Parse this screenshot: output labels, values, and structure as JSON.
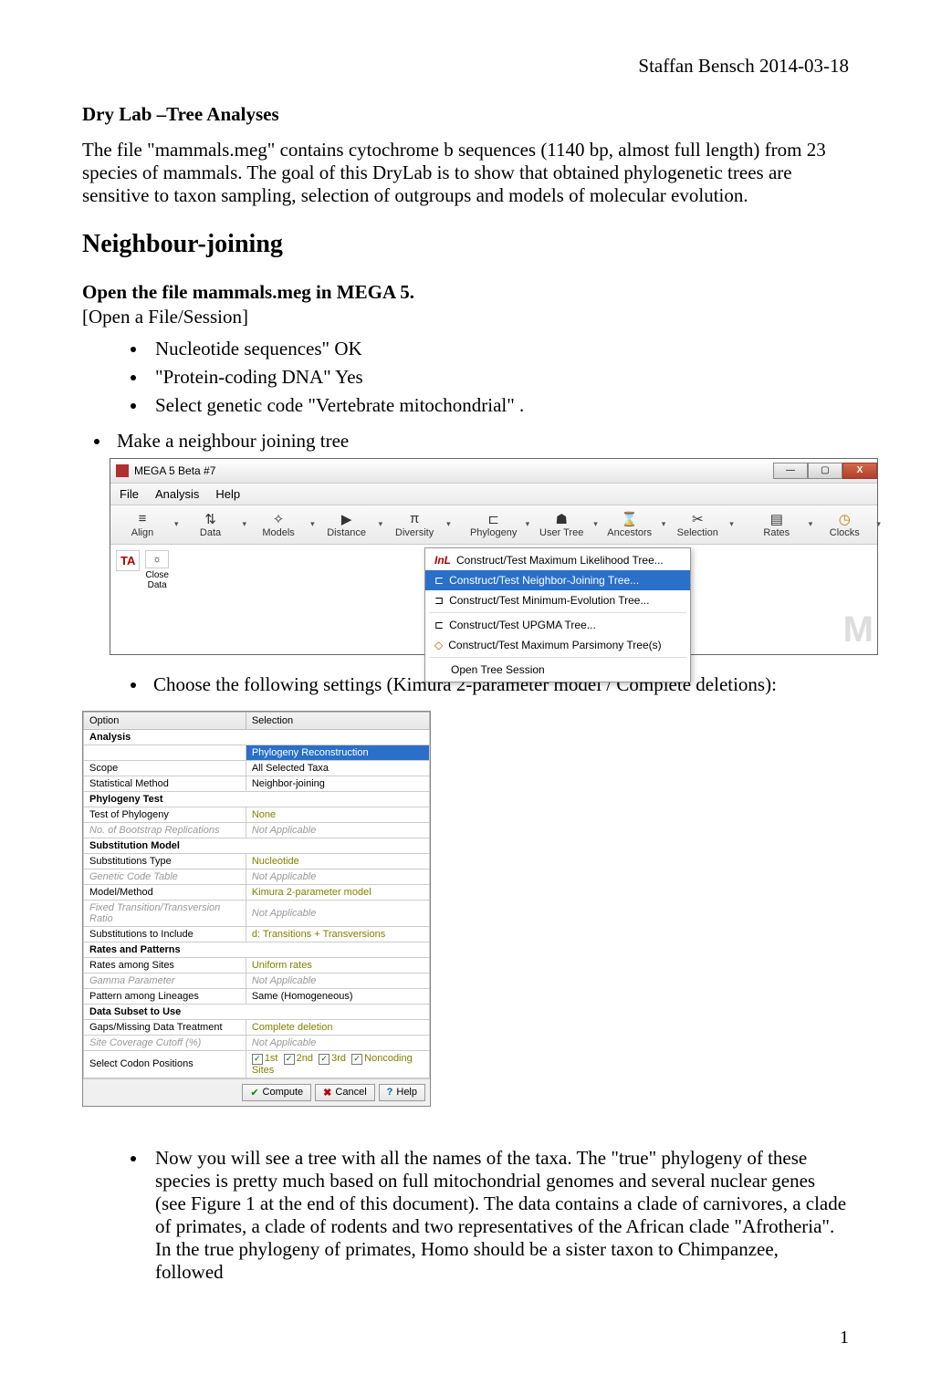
{
  "header": {
    "author_date": "Staffan Bensch 2014-03-18"
  },
  "title1": "Dry Lab –Tree Analyses",
  "intro": "The file \"mammals.meg\" contains cytochrome b sequences (1140 bp, almost full length) from 23 species of mammals. The goal of this DryLab is to show that obtained phylogenetic trees are sensitive to taxon sampling, selection of outgroups and models of molecular evolution.",
  "h1": "Neighbour-joining",
  "open_line": "Open the file mammals.meg in MEGA 5.",
  "open_sub": "[Open a File/Session]",
  "bullets_a": [
    "Nucleotide sequences\" OK",
    "\"Protein-coding DNA\" Yes",
    " Select genetic code \"Vertebrate mitochondrial\" ."
  ],
  "bullet_nj": "Make a neighbour joining tree",
  "mega": {
    "title": "MEGA 5 Beta #7",
    "menus": [
      "File",
      "Analysis",
      "Help"
    ],
    "toolbar": [
      {
        "label": "Align"
      },
      {
        "label": "Data"
      },
      {
        "label": "Models"
      },
      {
        "label": "Distance"
      },
      {
        "label": "Diversity"
      },
      {
        "label": "Phylogeny"
      },
      {
        "label": "User Tree"
      },
      {
        "label": "Ancestors"
      },
      {
        "label": "Selection"
      },
      {
        "label": "Rates"
      },
      {
        "label": "Clocks"
      }
    ],
    "left_boxes": {
      "ta": "TA",
      "sun": "☼",
      "close_data": "Close\nData"
    },
    "phylo_menu": {
      "ml": "Construct/Test Maximum Likelihood Tree...",
      "ml_prefix": "InL",
      "nj": "Construct/Test Neighbor-Joining Tree...",
      "me": "Construct/Test Minimum-Evolution Tree...",
      "upgma": "Construct/Test UPGMA Tree...",
      "mp": "Construct/Test Maximum Parsimony Tree(s)",
      "open": "Open Tree Session"
    },
    "watermark": "M"
  },
  "bullet_settings": "Choose the following settings (Kimura 2-parameter model / Complete deletions):",
  "opts": {
    "headers": [
      "Option",
      "Selection"
    ],
    "rows": [
      {
        "type": "group",
        "label": "Analysis"
      },
      {
        "type": "val",
        "label": "",
        "value": "Phylogeny Reconstruction",
        "highlight": true
      },
      {
        "type": "row",
        "label": "Scope",
        "value": "All Selected Taxa"
      },
      {
        "type": "row",
        "label": "Statistical Method",
        "value": "Neighbor-joining"
      },
      {
        "type": "group",
        "label": "Phylogeny Test"
      },
      {
        "type": "row",
        "label": "Test of Phylogeny",
        "value": "None",
        "yellow": true
      },
      {
        "type": "gray",
        "label": "No. of Bootstrap Replications",
        "value": "Not Applicable"
      },
      {
        "type": "group",
        "label": "Substitution Model"
      },
      {
        "type": "row",
        "label": "Substitutions Type",
        "value": "Nucleotide",
        "yellow": true
      },
      {
        "type": "gray",
        "label": "Genetic Code Table",
        "value": "Not Applicable"
      },
      {
        "type": "row",
        "label": "Model/Method",
        "value": "Kimura 2-parameter model",
        "yellow": true
      },
      {
        "type": "gray",
        "label": "Fixed Transition/Transversion Ratio",
        "value": "Not Applicable"
      },
      {
        "type": "row",
        "label": "Substitutions to Include",
        "value": "d: Transitions + Transversions",
        "yellow": true
      },
      {
        "type": "group",
        "label": "Rates and Patterns"
      },
      {
        "type": "row",
        "label": "Rates among Sites",
        "value": "Uniform rates",
        "yellow": true
      },
      {
        "type": "gray",
        "label": "Gamma Parameter",
        "value": "Not Applicable"
      },
      {
        "type": "row",
        "label": "Pattern among Lineages",
        "value": "Same (Homogeneous)"
      },
      {
        "type": "group",
        "label": "Data Subset to Use"
      },
      {
        "type": "row",
        "label": "Gaps/Missing Data Treatment",
        "value": "Complete deletion",
        "yellow": true
      },
      {
        "type": "gray",
        "label": "Site Coverage Cutoff (%)",
        "value": "Not Applicable"
      }
    ],
    "codon_row": {
      "label": "Select Codon Positions",
      "checks": [
        "1st",
        "2nd",
        "3rd",
        "Noncoding Sites"
      ]
    },
    "buttons": {
      "compute": "Compute",
      "cancel": "Cancel",
      "help": "Help"
    }
  },
  "bullet_tree": "Now you will see a tree with all the names of the taxa. The \"true\" phylogeny of these species is pretty much based on full mitochondrial genomes and several nuclear genes (see Figure 1 at the end of this document). The data contains a clade of carnivores, a clade of primates, a clade of rodents and two representatives of the African clade \"Afrotheria\". In the true phylogeny of primates, Homo should be a sister taxon to Chimpanzee, followed",
  "page_number": "1"
}
